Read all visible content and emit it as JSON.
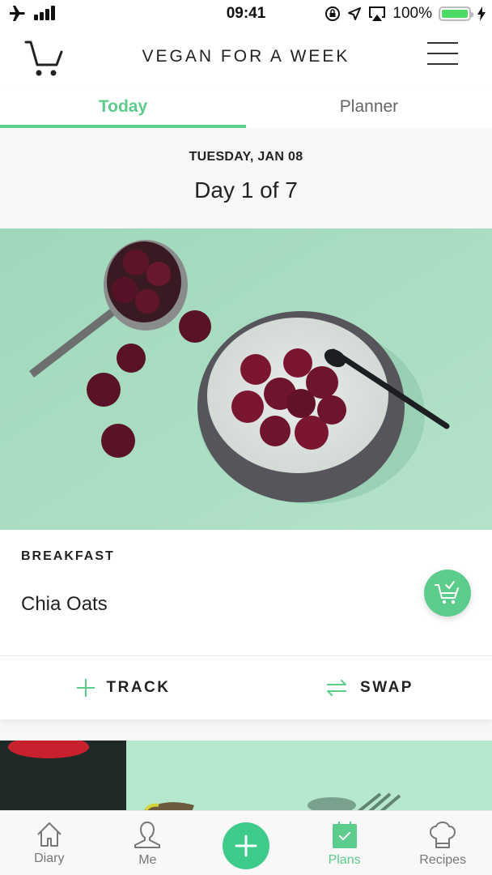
{
  "status_bar": {
    "time": "09:41",
    "battery_percent": "100%",
    "icons": [
      "airplane-icon",
      "signal-icon",
      "orientation-lock-icon",
      "location-icon",
      "airplay-icon",
      "battery-icon",
      "charging-icon"
    ]
  },
  "header": {
    "title": "VEGAN FOR A WEEK",
    "left_icon": "cart-icon",
    "right_icon": "menu-icon"
  },
  "tabs": [
    {
      "label": "Today",
      "active": true
    },
    {
      "label": "Planner",
      "active": false
    }
  ],
  "day": {
    "date": "TUESDAY, JAN 08",
    "progress": "Day 1 of 7"
  },
  "meal": {
    "type": "BREAKFAST",
    "name": "Chia Oats",
    "image_alt": "Chia oats bowl with cherries",
    "actions": [
      {
        "label": "TRACK",
        "icon": "plus-icon"
      },
      {
        "label": "SWAP",
        "icon": "swap-icon"
      }
    ]
  },
  "bottom_nav": [
    {
      "label": "Diary",
      "icon": "home-icon",
      "active": false
    },
    {
      "label": "Me",
      "icon": "person-icon",
      "active": false
    },
    {
      "label": "",
      "icon": "add-icon",
      "active": false
    },
    {
      "label": "Plans",
      "icon": "calendar-check-icon",
      "active": true
    },
    {
      "label": "Recipes",
      "icon": "chef-hat-icon",
      "active": false
    }
  ],
  "colors": {
    "accent": "#5ccc8c",
    "photo_bg": "#a9dcc1",
    "text": "#222222"
  }
}
